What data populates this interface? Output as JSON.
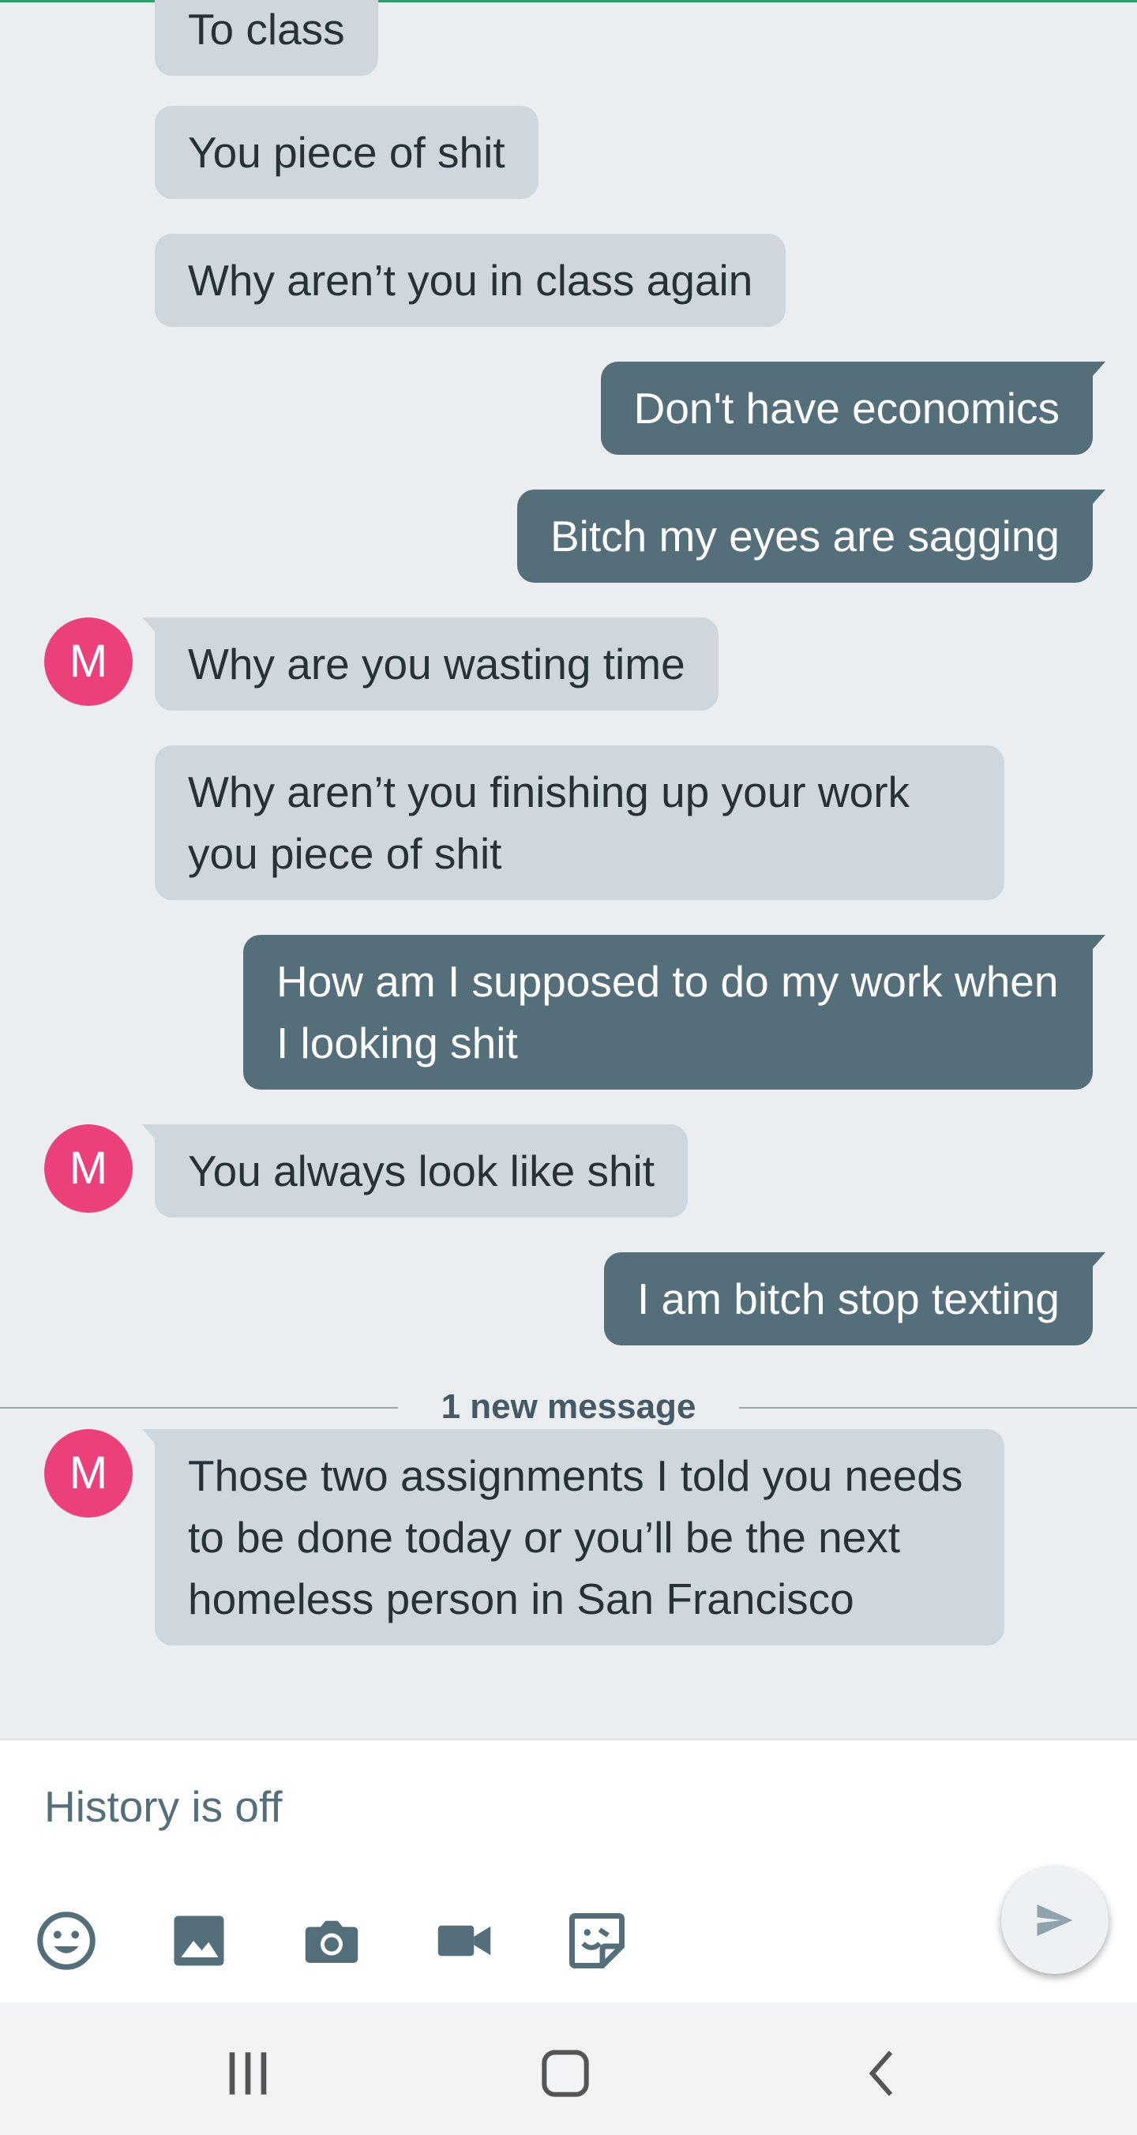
{
  "messages": [
    {
      "text": "To class",
      "direction": "incoming"
    },
    {
      "text": "You piece of shit",
      "direction": "incoming"
    },
    {
      "text": "Why aren’t you in class again",
      "direction": "incoming"
    },
    {
      "text": "Don't have economics",
      "direction": "outgoing"
    },
    {
      "text": "Bitch my eyes are sagging",
      "direction": "outgoing"
    },
    {
      "text": "Why are you wasting time",
      "direction": "incoming",
      "avatar": "M"
    },
    {
      "text": "Why aren’t you finishing up your work you piece of shit",
      "direction": "incoming"
    },
    {
      "text": "How am I supposed to do my work when I looking shit",
      "direction": "outgoing"
    },
    {
      "text": "You always look like shit",
      "direction": "incoming",
      "avatar": "M"
    },
    {
      "text": "I am bitch stop texting",
      "direction": "outgoing"
    },
    {
      "text": "Those two assignments I told you needs to be done today or you’ll be the next homeless person in San Francisco",
      "direction": "incoming",
      "avatar": "M"
    }
  ],
  "new_message_divider": "1 new message",
  "avatar_letter": "M",
  "composer": {
    "status_text": "History is off"
  },
  "toolbar_icons": [
    "emoji-icon",
    "gallery-icon",
    "camera-icon",
    "video-icon",
    "sticker-icon"
  ],
  "send_icon": "send-icon",
  "nav_icons": [
    "recents-icon",
    "home-icon",
    "back-icon"
  ],
  "colors": {
    "incoming_bubble": "#cfd7dd",
    "outgoing_bubble": "#546e7a",
    "avatar": "#ec407a",
    "background": "#ebeef1"
  }
}
